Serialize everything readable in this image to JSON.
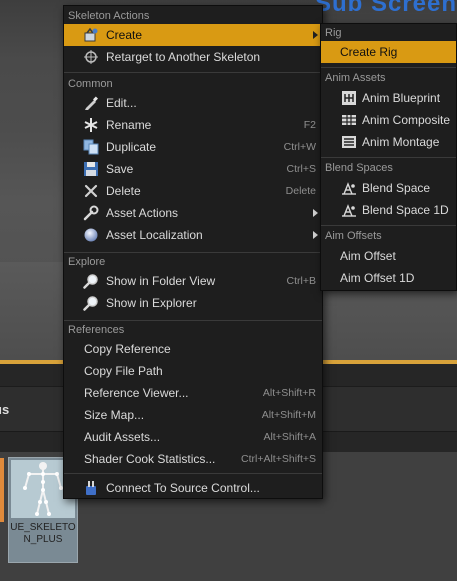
{
  "background": {
    "title_fragment": "Sub Screen",
    "panel_header": "us",
    "asset": {
      "name": "UE_SKELETON_PLUS",
      "type": "Skeleton"
    }
  },
  "main_menu": {
    "sections": [
      {
        "title": "Skeleton Actions",
        "items": [
          {
            "label": "Create",
            "icon": "create-icon",
            "shortcut": "",
            "submenu": true,
            "highlighted": true
          },
          {
            "label": "Retarget to Another Skeleton",
            "icon": "retarget-icon",
            "shortcut": "",
            "submenu": false
          }
        ]
      },
      {
        "title": "Common",
        "items": [
          {
            "label": "Edit...",
            "icon": "edit-icon",
            "shortcut": ""
          },
          {
            "label": "Rename",
            "icon": "rename-icon",
            "shortcut": "F2"
          },
          {
            "label": "Duplicate",
            "icon": "duplicate-icon",
            "shortcut": "Ctrl+W"
          },
          {
            "label": "Save",
            "icon": "save-icon",
            "shortcut": "Ctrl+S"
          },
          {
            "label": "Delete",
            "icon": "delete-icon",
            "shortcut": "Delete"
          },
          {
            "label": "Asset Actions",
            "icon": "wrench-icon",
            "shortcut": "",
            "submenu": true
          },
          {
            "label": "Asset Localization",
            "icon": "globe-icon",
            "shortcut": "",
            "submenu": true
          }
        ]
      },
      {
        "title": "Explore",
        "items": [
          {
            "label": "Show in Folder View",
            "icon": "magnifier-icon",
            "shortcut": "Ctrl+B"
          },
          {
            "label": "Show in Explorer",
            "icon": "magnifier-icon",
            "shortcut": ""
          }
        ]
      },
      {
        "title": "References",
        "items": [
          {
            "label": "Copy Reference",
            "shortcut": ""
          },
          {
            "label": "Copy File Path",
            "shortcut": ""
          },
          {
            "label": "Reference Viewer...",
            "shortcut": "Alt+Shift+R"
          },
          {
            "label": "Size Map...",
            "shortcut": "Alt+Shift+M"
          },
          {
            "label": "Audit Assets...",
            "shortcut": "Alt+Shift+A"
          },
          {
            "label": "Shader Cook Statistics...",
            "shortcut": "Ctrl+Alt+Shift+S"
          }
        ]
      },
      {
        "title": "",
        "items": [
          {
            "label": "Connect To Source Control...",
            "icon": "source-control-icon",
            "shortcut": ""
          }
        ]
      }
    ]
  },
  "sub_menu": {
    "sections": [
      {
        "title": "Rig",
        "items": [
          {
            "label": "Create Rig",
            "highlighted": true
          }
        ]
      },
      {
        "title": "Anim Assets",
        "items": [
          {
            "label": "Anim Blueprint",
            "icon": "anim-blueprint-icon"
          },
          {
            "label": "Anim Composite",
            "icon": "anim-composite-icon"
          },
          {
            "label": "Anim Montage",
            "icon": "anim-montage-icon"
          }
        ]
      },
      {
        "title": "Blend Spaces",
        "items": [
          {
            "label": "Blend Space",
            "icon": "blend-space-icon"
          },
          {
            "label": "Blend Space 1D",
            "icon": "blend-space-1d-icon"
          }
        ]
      },
      {
        "title": "Aim Offsets",
        "items": [
          {
            "label": "Aim Offset"
          },
          {
            "label": "Aim Offset 1D"
          }
        ]
      }
    ]
  },
  "colors": {
    "highlight": "#d99a13",
    "menu_bg": "#1e1e1e",
    "accent_orange": "#d8a23a"
  }
}
